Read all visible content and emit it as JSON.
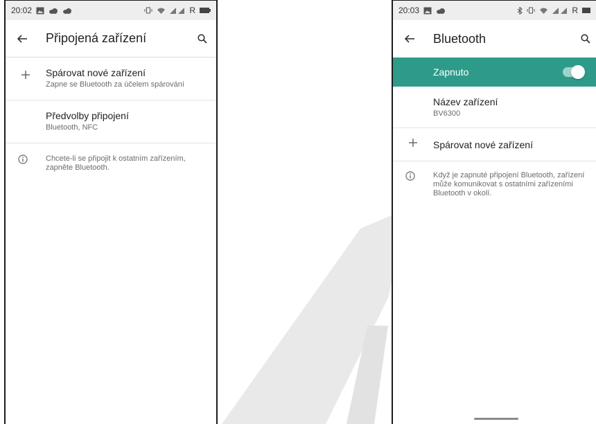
{
  "left": {
    "status": {
      "time": "20:02",
      "right_text": "R"
    },
    "appbar": {
      "title": "Připojená zařízení"
    },
    "items": [
      {
        "title": "Spárovat nové zařízení",
        "subtitle": "Zapne se Bluetooth za účelem spárování"
      },
      {
        "title": "Předvolby připojení",
        "subtitle": "Bluetooth, NFC"
      }
    ],
    "info": "Chcete-li se připojit k ostatním zařízením, zapněte Bluetooth."
  },
  "right": {
    "status": {
      "time": "20:03",
      "right_text": "R"
    },
    "appbar": {
      "title": "Bluetooth"
    },
    "toggle": {
      "label": "Zapnuto",
      "state": "on"
    },
    "device_name": {
      "title": "Název zařízení",
      "value": "BV6300"
    },
    "pair": {
      "title": "Spárovat nové zařízení"
    },
    "info": "Když je zapnuté připojení Bluetooth, zařízení může komunikovat s ostatními zařízeními Bluetooth v okolí."
  },
  "colors": {
    "accent": "#2e9b8a",
    "watermark": "#e6e6e6"
  }
}
